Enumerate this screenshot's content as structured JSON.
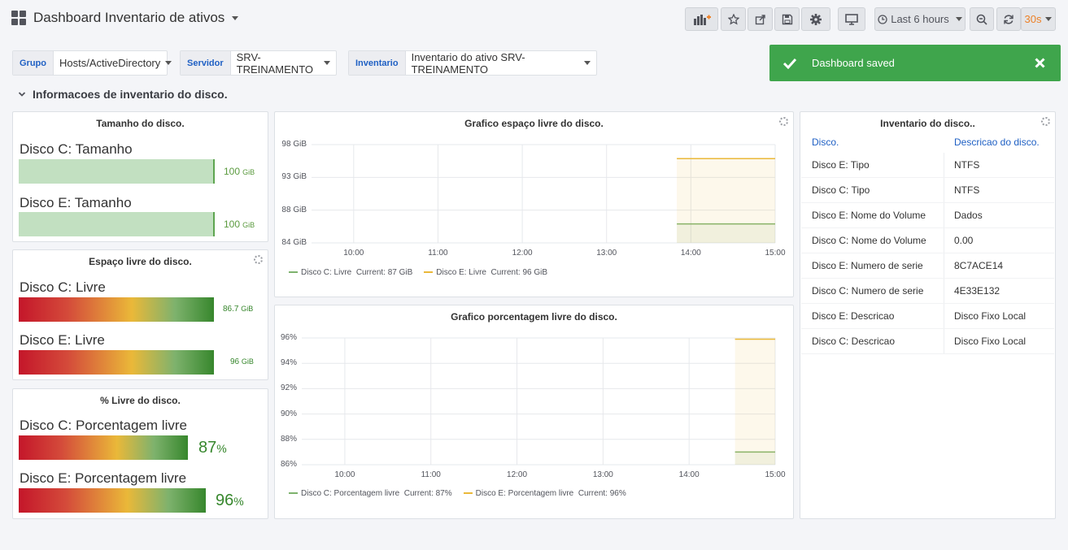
{
  "header": {
    "title": "Dashboard Inventario de ativos",
    "time_range": "Last 6 hours",
    "refresh": "30s"
  },
  "variables": [
    {
      "label": "Grupo",
      "value": "Hosts/ActiveDirectory"
    },
    {
      "label": "Servidor",
      "value": "SRV-TREINAMENTO"
    },
    {
      "label": "Inventario",
      "value": "Inventario do ativo SRV-TREINAMENTO"
    }
  ],
  "toast": {
    "message": "Dashboard saved"
  },
  "row": {
    "title": "Informacoes de inventario do disco."
  },
  "panels": {
    "size": {
      "title": "Tamanho do disco.",
      "items": [
        {
          "label": "Disco C: Tamanho",
          "value": "100",
          "unit": "GiB",
          "fill": 1.0
        },
        {
          "label": "Disco E: Tamanho",
          "value": "100",
          "unit": "GiB",
          "fill": 1.0
        }
      ]
    },
    "free": {
      "title": "Espaço livre do disco.",
      "items": [
        {
          "label": "Disco C: Livre",
          "value": "86.7",
          "unit": "GiB",
          "fill": 0.867
        },
        {
          "label": "Disco E: Livre",
          "value": "96",
          "unit": "GiB",
          "fill": 0.96
        }
      ]
    },
    "pct": {
      "title": "% Livre do disco.",
      "items": [
        {
          "label": "Disco C: Porcentagem livre",
          "value": "87",
          "unit": "%",
          "fill": 0.87
        },
        {
          "label": "Disco E: Porcentagem livre",
          "value": "96",
          "unit": "%",
          "fill": 0.96
        }
      ]
    },
    "inventory": {
      "title": "Inventario do disco..",
      "col1": "Disco.",
      "col2": "Descricao do disco.",
      "rows": [
        [
          "Disco E: Tipo",
          "NTFS"
        ],
        [
          "Disco C: Tipo",
          "NTFS"
        ],
        [
          "Disco E: Nome do Volume",
          "Dados"
        ],
        [
          "Disco C: Nome do Volume",
          "0.00"
        ],
        [
          "Disco E: Numero de serie",
          "8C7ACE14"
        ],
        [
          "Disco C: Numero de serie",
          "4E33E132"
        ],
        [
          "Disco E: Descricao",
          "Disco Fixo Local"
        ],
        [
          "Disco C: Descricao",
          "Disco Fixo Local"
        ]
      ]
    }
  },
  "colors": {
    "green": "#7eb26d",
    "yellow": "#eab839",
    "toast": "#3fa54c",
    "link": "#1f60c4"
  },
  "chart_data": [
    {
      "type": "line",
      "title": "Grafico espaço livre do disco.",
      "y_ticks": [
        "98 GiB",
        "93 GiB",
        "88 GiB",
        "84 GiB"
      ],
      "x_ticks": [
        "10:00",
        "11:00",
        "12:00",
        "13:00",
        "14:00",
        "15:00"
      ],
      "ylim": [
        84,
        98
      ],
      "series": [
        {
          "name": "Disco C: Livre",
          "legend": "Current: 87 GiB",
          "color": "#7eb26d",
          "x": [
            "13:50",
            "15:00"
          ],
          "values": [
            86.7,
            86.7
          ]
        },
        {
          "name": "Disco E: Livre",
          "legend": "Current: 96 GiB",
          "color": "#eab839",
          "x": [
            "13:50",
            "15:00"
          ],
          "values": [
            96,
            96
          ]
        }
      ]
    },
    {
      "type": "line",
      "title": "Grafico porcentagem livre do disco.",
      "y_ticks": [
        "96%",
        "94%",
        "92%",
        "90%",
        "88%",
        "86%"
      ],
      "x_ticks": [
        "10:00",
        "11:00",
        "12:00",
        "13:00",
        "14:00",
        "15:00"
      ],
      "ylim": [
        86,
        96
      ],
      "series": [
        {
          "name": "Disco C: Porcentagem livre",
          "legend": "Current: 87%",
          "color": "#7eb26d",
          "x": [
            "14:32",
            "15:00"
          ],
          "values": [
            87,
            87
          ]
        },
        {
          "name": "Disco E: Porcentagem livre",
          "legend": "Current: 96%",
          "color": "#eab839",
          "x": [
            "14:32",
            "15:00"
          ],
          "values": [
            95.9,
            95.9
          ]
        }
      ]
    }
  ]
}
